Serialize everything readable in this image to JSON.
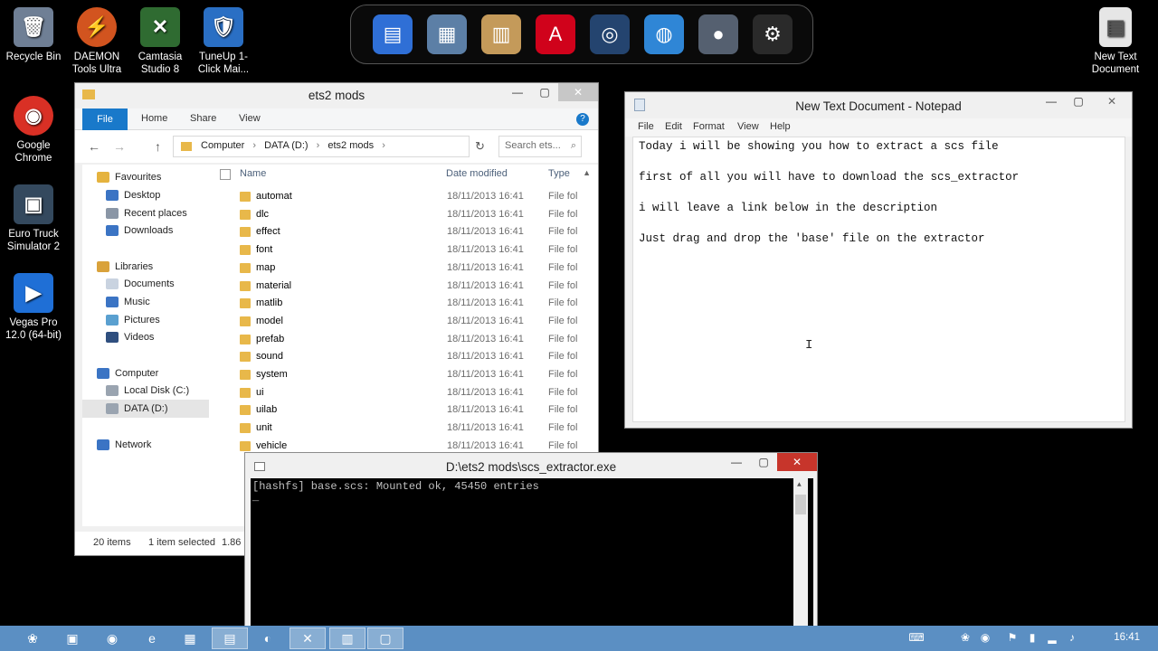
{
  "desktop": {
    "icons": [
      {
        "label": "Recycle Bin",
        "glyph": "🗑",
        "color": "#6f7f95"
      },
      {
        "label": "DAEMON Tools Ultra",
        "glyph": "⚡",
        "color": "#d2541f"
      },
      {
        "label": "Camtasia Studio 8",
        "glyph": "✕",
        "color": "#2f6b31"
      },
      {
        "label": "TuneUp 1-Click Mai...",
        "glyph": "🛡",
        "color": "#2a6fc4"
      },
      {
        "label": "Google Chrome",
        "glyph": "◉",
        "color": "#d93025"
      },
      {
        "label": "Euro Truck Simulator 2",
        "glyph": "▣",
        "color": "#34495e"
      },
      {
        "label": "Vegas Pro 12.0 (64-bit)",
        "glyph": "▶",
        "color": "#1f6fd6"
      },
      {
        "label": "New Text Document",
        "glyph": "▤",
        "color": "#e6e6e6"
      }
    ]
  },
  "dock": {
    "items": [
      {
        "icon": "contacts-icon",
        "glyph": "▤",
        "color": "#2f6fd6"
      },
      {
        "icon": "network-icon",
        "glyph": "▦",
        "color": "#5c7fa6"
      },
      {
        "icon": "documents-icon",
        "glyph": "▥",
        "color": "#c49a5a"
      },
      {
        "icon": "pdf-icon",
        "glyph": "A",
        "color": "#d0021b"
      },
      {
        "icon": "media-icon",
        "glyph": "◎",
        "color": "#24446f"
      },
      {
        "icon": "browser-icon",
        "glyph": "◍",
        "color": "#2f86d6"
      },
      {
        "icon": "globe-icon",
        "glyph": "●",
        "color": "#556070"
      },
      {
        "icon": "gear-icon",
        "glyph": "⚙",
        "color": "#2a2a2a"
      }
    ]
  },
  "explorer": {
    "title": "ets2 mods",
    "ribbon": {
      "file": "File",
      "home": "Home",
      "share": "Share",
      "view": "View"
    },
    "address": [
      "Computer",
      "DATA (D:)",
      "ets2 mods"
    ],
    "search_placeholder": "Search ets...",
    "nav": {
      "favourites": "Favourites",
      "desktop": "Desktop",
      "recent": "Recent places",
      "downloads": "Downloads",
      "libraries": "Libraries",
      "documents": "Documents",
      "music": "Music",
      "pictures": "Pictures",
      "videos": "Videos",
      "computer": "Computer",
      "local_disk": "Local Disk (C:)",
      "data_disk": "DATA (D:)",
      "network": "Network"
    },
    "columns": {
      "name": "Name",
      "date": "Date modified",
      "type": "Type"
    },
    "rows": [
      {
        "name": "automat",
        "date": "18/11/2013 16:41",
        "type": "File fol"
      },
      {
        "name": "dlc",
        "date": "18/11/2013 16:41",
        "type": "File fol"
      },
      {
        "name": "effect",
        "date": "18/11/2013 16:41",
        "type": "File fol"
      },
      {
        "name": "font",
        "date": "18/11/2013 16:41",
        "type": "File fol"
      },
      {
        "name": "map",
        "date": "18/11/2013 16:41",
        "type": "File fol"
      },
      {
        "name": "material",
        "date": "18/11/2013 16:41",
        "type": "File fol"
      },
      {
        "name": "matlib",
        "date": "18/11/2013 16:41",
        "type": "File fol"
      },
      {
        "name": "model",
        "date": "18/11/2013 16:41",
        "type": "File fol"
      },
      {
        "name": "prefab",
        "date": "18/11/2013 16:41",
        "type": "File fol"
      },
      {
        "name": "sound",
        "date": "18/11/2013 16:41",
        "type": "File fol"
      },
      {
        "name": "system",
        "date": "18/11/2013 16:41",
        "type": "File fol"
      },
      {
        "name": "ui",
        "date": "18/11/2013 16:41",
        "type": "File fol"
      },
      {
        "name": "uilab",
        "date": "18/11/2013 16:41",
        "type": "File fol"
      },
      {
        "name": "unit",
        "date": "18/11/2013 16:41",
        "type": "File fol"
      },
      {
        "name": "vehicle",
        "date": "18/11/2013 16:41",
        "type": "File fol"
      }
    ],
    "status": {
      "count": "20 items",
      "selected": "1 item selected",
      "size": "1.86 G"
    }
  },
  "notepad": {
    "title": "New Text Document - Notepad",
    "menu": {
      "file": "File",
      "edit": "Edit",
      "format": "Format",
      "view": "View",
      "help": "Help"
    },
    "lines": [
      "Today i will be showing you how to extract a scs file",
      "first of all you will have to download the scs_extractor",
      "i will leave a link below in the description",
      "Just drag and drop the 'base' file on the extractor"
    ]
  },
  "console": {
    "title": "D:\\ets2 mods\\scs_extractor.exe",
    "output": "[hashfs] base.scs: Mounted ok, 45450 entries",
    "cursor": "_"
  },
  "taskbar": {
    "clock": "16:41"
  }
}
